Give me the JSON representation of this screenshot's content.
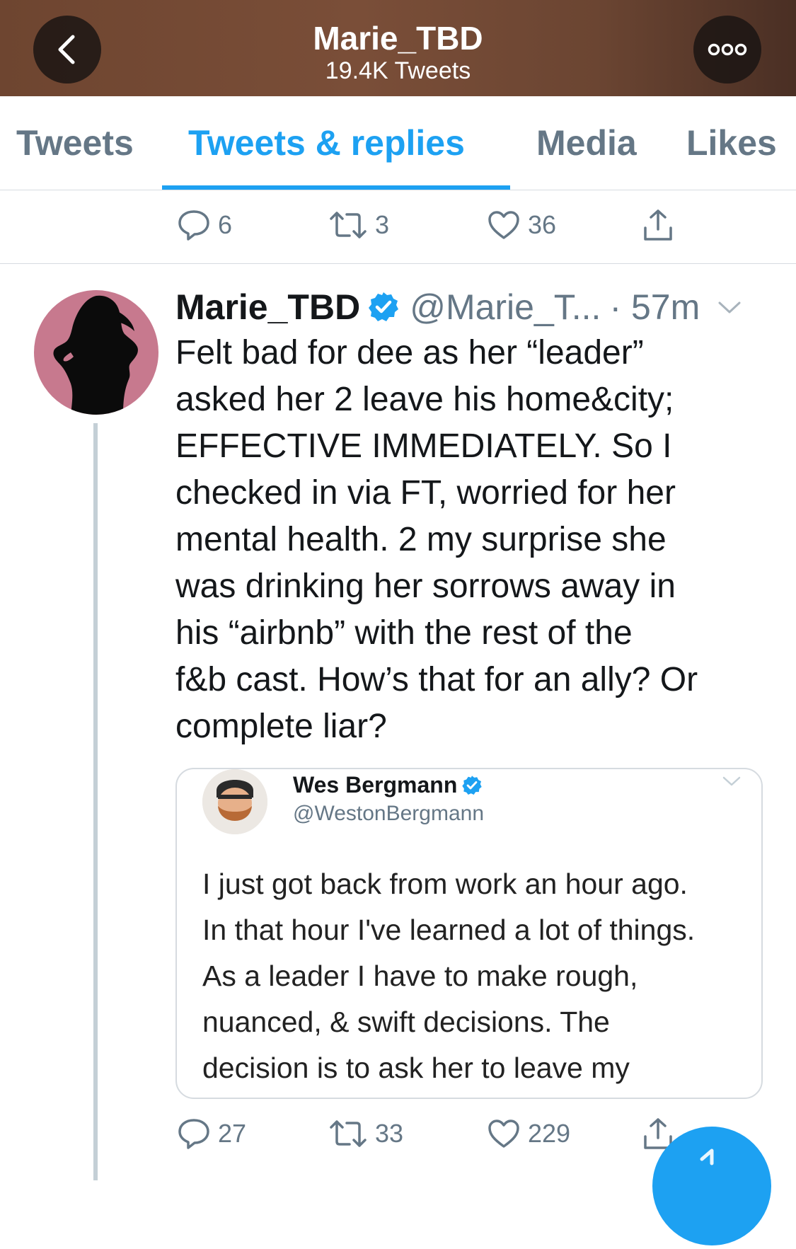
{
  "header": {
    "title": "Marie_TBD",
    "subtitle": "19.4K Tweets",
    "bg_color": "#6e4530"
  },
  "tabs": [
    {
      "label": "Tweets"
    },
    {
      "label": "Tweets & replies",
      "active": true
    },
    {
      "label": "Media"
    },
    {
      "label": "Likes"
    }
  ],
  "prev_tweet_actions": {
    "replies": "6",
    "retweets": "3",
    "likes": "36"
  },
  "tweet": {
    "name": "Marie_TBD",
    "handle": "@Marie_T...",
    "time": "· 57m",
    "verified": true,
    "lines": [
      "Felt bad for dee as her “leader”",
      "asked her 2 leave his home&city;",
      "EFFECTIVE IMMEDIATELY. So I",
      "checked in via FT, worried for her",
      "mental health. 2 my surprise she",
      "was drinking her sorrows away in",
      "his “airbnb” with the rest of the",
      "f&b cast. How’s that for an ally? Or",
      "complete liar?"
    ],
    "quoted": {
      "name": "Wes Bergmann",
      "handle": "@WestonBergmann",
      "lines": [
        "I just got back from work an hour ago.",
        "In that hour I've learned a lot of things.",
        "As a leader I have to make rough,",
        "nuanced, & swift decisions. The",
        "decision is to ask her to leave my"
      ]
    },
    "actions": {
      "replies": "27",
      "retweets": "33",
      "likes": "229"
    }
  },
  "colors": {
    "accent": "#1da1f2",
    "muted": "#657786",
    "avatar_bg": "#c7798e"
  }
}
